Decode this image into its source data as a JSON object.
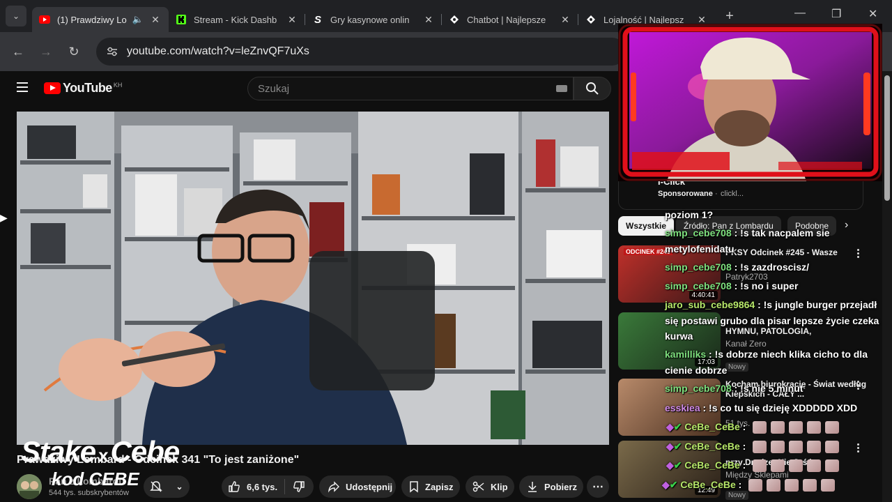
{
  "browser": {
    "tabs": [
      {
        "title": "(1) Prawdziwy Lo",
        "active": true,
        "icon": "youtube-icon"
      },
      {
        "title": "Stream - Kick Dashb",
        "icon": "kick-icon"
      },
      {
        "title": "Gry kasynowe onlin",
        "icon": "stake-icon"
      },
      {
        "title": "Chatbot | Najlepsze",
        "icon": "bot-icon"
      },
      {
        "title": "Lojalność | Najlepsz",
        "icon": "bot-icon"
      }
    ],
    "url": "youtube.com/watch?v=leZnvQF7uXs"
  },
  "youtube": {
    "logo_text": "YouTube",
    "country_code": "KH",
    "search_placeholder": "Szukaj",
    "video_title": "Prawdziwy Lombard - Odcinek 341 \"To jest zaniżone\"",
    "channel_name": "Pan z Lombardu",
    "subscribers": "544 tys. subskrybentów",
    "likes": "6,6 tys.",
    "share_label": "Udostępnij",
    "save_label": "Zapisz",
    "clip_label": "Klip",
    "download_label": "Pobierz"
  },
  "overlay": {
    "brand_line1_left": "Stake",
    "brand_line1_x": "x",
    "brand_line1_right": "Cebe",
    "brand_line2": "kod CEBE"
  },
  "sidebar": {
    "sponsor_title": "I-Click",
    "sponsor_label": "Sponsorowane",
    "sponsor_domain": "clickl...",
    "chips": [
      "Wszystkie",
      "Źródło: Pan z Lombardu",
      "Podobne"
    ],
    "videos": [
      {
        "title": "PKSY Odcinek #245 - Wasze",
        "meta": "Patryk2703",
        "duration": "4:40:41",
        "badge": "ODCINEK #245"
      },
      {
        "title": "HYMNU, PATOLOGIA,",
        "meta": "Kanał Zero",
        "duration": "17:03",
        "status": "Nowy"
      },
      {
        "title": "Kocham biurokrację - Świat według Kiepskich - CAŁY ...",
        "meta": "51 tys.",
        "duration": ""
      },
      {
        "title": "przy Dredze: Nie Jeść...",
        "meta": "Między Sklepami",
        "duration": "12:49",
        "status": "Nowy"
      }
    ]
  },
  "chat": [
    {
      "user": "",
      "text": "poziom 1?"
    },
    {
      "user": "simp_cebe708",
      "text": ": !s tak nacpalem sie"
    },
    {
      "user": "",
      "text": "metylofenidatu"
    },
    {
      "user": "simp_cebe708",
      "text": ": !s zazdroscisz/"
    },
    {
      "user": "simp_cebe708",
      "text": ": !s no i super"
    },
    {
      "user": "jaro_sub_cebe9864",
      "text": ": !s jungle burger przejadł"
    },
    {
      "user": "",
      "text": "się postawi grubo dla pisar lepsze życie czeka"
    },
    {
      "user": "",
      "text": "kurwa"
    },
    {
      "user": "kamilliks",
      "text": ": !s dobrze niech klika cicho to dla"
    },
    {
      "user": "",
      "text": "cienie dobrze"
    },
    {
      "user": "simp_cebe708",
      "text": ": !s nie 5 minut"
    },
    {
      "user": "esskiea",
      "text": ": !s co tu się dzieję XDDDDD XDD"
    },
    {
      "user": "CeBe_CeBe",
      "text": ":"
    },
    {
      "user": "CeBe_CeBe",
      "text": ":"
    },
    {
      "user": "CeBe_CeBe",
      "text": ":"
    },
    {
      "user": "CeBe_CeBe",
      "text": ":"
    }
  ],
  "colors": {
    "accent": "#ff0000",
    "chat_user": "#7ee07e",
    "webcam_frame": "#e0101a"
  }
}
